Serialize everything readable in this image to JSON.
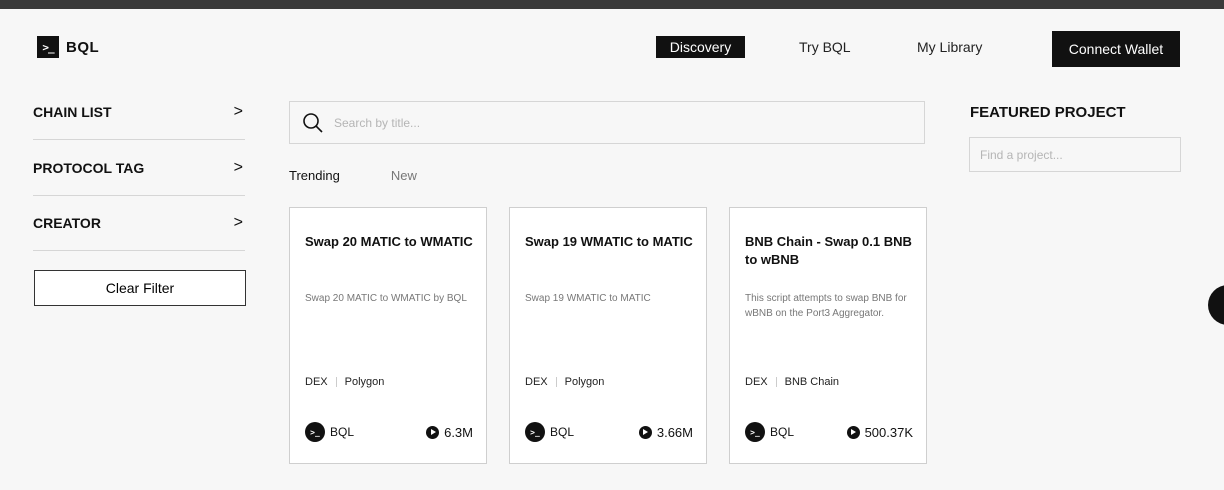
{
  "header": {
    "logo_mark": ">_",
    "logo_text": "BQL",
    "nav": [
      "Discovery",
      "Try BQL",
      "My Library"
    ],
    "active_nav": "Discovery",
    "connect_label": "Connect Wallet"
  },
  "sidebar": {
    "filters": [
      "CHAIN LIST",
      "PROTOCOL TAG",
      "CREATOR"
    ],
    "chevron": ">",
    "clear_label": "Clear Filter"
  },
  "search": {
    "placeholder": "Search by title..."
  },
  "tabs": [
    "Trending",
    "New"
  ],
  "active_tab": "Trending",
  "cards": [
    {
      "title": "Swap 20 MATIC to WMATIC",
      "description": "Swap 20 MATIC to WMATIC by BQL",
      "tags": [
        "DEX",
        "Polygon"
      ],
      "creator": "BQL",
      "runs": "6.3M"
    },
    {
      "title": "Swap 19 WMATIC to MATIC",
      "description": "Swap 19 WMATIC to MATIC",
      "tags": [
        "DEX",
        "Polygon"
      ],
      "creator": "BQL",
      "runs": "3.66M"
    },
    {
      "title": "BNB Chain - Swap 0.1 BNB to wBNB",
      "description": "This script attempts to swap BNB for wBNB on the Port3 Aggregator.",
      "tags": [
        "DEX",
        "BNB Chain"
      ],
      "creator": "BQL",
      "runs": "500.37K"
    }
  ],
  "featured": {
    "title": "FEATURED PROJECT",
    "placeholder": "Find a project..."
  }
}
